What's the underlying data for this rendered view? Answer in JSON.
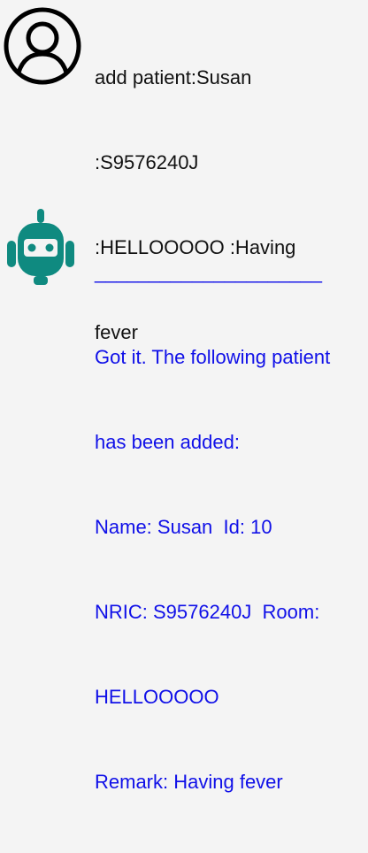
{
  "user": {
    "avatar_icon": "user-icon",
    "lines": [
      "add patient:Susan",
      ":S9576240J",
      ":HELLOOOOO :Having",
      "fever"
    ]
  },
  "bot": {
    "avatar_icon": "robot-icon",
    "accent_color": "#0f8a80",
    "text_color": "#1010e8",
    "lines": [
      "_____________________",
      "Got it. The following patient",
      "has been added:",
      "Name: Susan  Id: 10",
      "NRIC: S9576240J  Room:",
      "HELLOOOOO",
      "Remark: Having fever"
    ]
  }
}
